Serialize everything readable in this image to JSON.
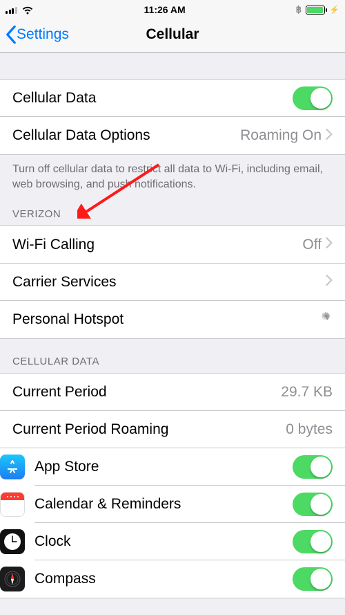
{
  "status": {
    "time": "11:26 AM"
  },
  "nav": {
    "back": "Settings",
    "title": "Cellular"
  },
  "cellular_data": {
    "label": "Cellular Data",
    "options_label": "Cellular Data Options",
    "options_detail": "Roaming On",
    "footer": "Turn off cellular data to restrict all data to Wi-Fi, including email, web browsing, and push notifications."
  },
  "carrier": {
    "header": "VERIZON",
    "wifi_calling_label": "Wi-Fi Calling",
    "wifi_calling_detail": "Off",
    "carrier_services_label": "Carrier Services",
    "hotspot_label": "Personal Hotspot"
  },
  "usage": {
    "header": "CELLULAR DATA",
    "current_period_label": "Current Period",
    "current_period_value": "29.7 KB",
    "roaming_label": "Current Period Roaming",
    "roaming_value": "0 bytes"
  },
  "apps": [
    {
      "name": "App Store"
    },
    {
      "name": "Calendar & Reminders"
    },
    {
      "name": "Clock"
    },
    {
      "name": "Compass"
    }
  ]
}
